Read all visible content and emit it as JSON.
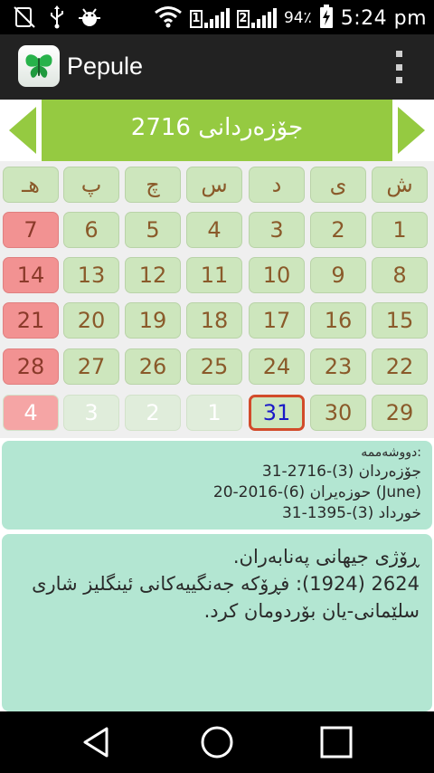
{
  "status_bar": {
    "sim1": "1",
    "sim2": "2",
    "battery_pct": "94٪",
    "time": "5:24 pm",
    "icons": [
      "no-sim-icon",
      "usb-icon",
      "android-debug-icon",
      "wifi-icon",
      "signal-icon",
      "battery-charging-icon"
    ]
  },
  "app_bar": {
    "title": "Pepule",
    "logo_icon": "butterfly-icon",
    "menu_icon": "overflow-menu-icon"
  },
  "month_header": {
    "title": "جۆزەردانی 2716",
    "prev_icon": "chevron-left-icon",
    "next_icon": "chevron-right-icon"
  },
  "calendar": {
    "weekday_headers": [
      "ش",
      "ی",
      "د",
      "س",
      "چ",
      "پ",
      "هـ"
    ],
    "weeks": [
      [
        "1",
        "2",
        "3",
        "4",
        "5",
        "6",
        "7"
      ],
      [
        "8",
        "9",
        "10",
        "11",
        "12",
        "13",
        "14"
      ],
      [
        "15",
        "16",
        "17",
        "18",
        "19",
        "20",
        "21"
      ],
      [
        "22",
        "23",
        "24",
        "25",
        "26",
        "27",
        "28"
      ],
      [
        "29",
        "30",
        "31",
        "1",
        "2",
        "3",
        "4"
      ]
    ],
    "today": "31"
  },
  "date_info": {
    "weekday": "دووشەممە:",
    "kurdish_date": "31-جۆزەردان (3)-2716",
    "gregorian_date": "20-حوزەیران (6)-2016 (June)",
    "persian_date": "31-خورداد (3)-1395"
  },
  "events": {
    "line1": "ڕۆژی جیهانی پەنابەران.",
    "line2": "2624 (1924): فڕۆکە جەنگییەکانی ئینگلیز شاری",
    "line3": "سلێمانی-یان بۆردومان کرد."
  },
  "nav_bar": {
    "icons": [
      "back-icon",
      "home-icon",
      "recents-icon"
    ]
  },
  "colors": {
    "accent_green": "#95ca41",
    "day_cell": "#cde6bd",
    "weekend_cell": "#f29292",
    "info_panel": "#b3e6d2",
    "today_border": "#d24b2a"
  }
}
